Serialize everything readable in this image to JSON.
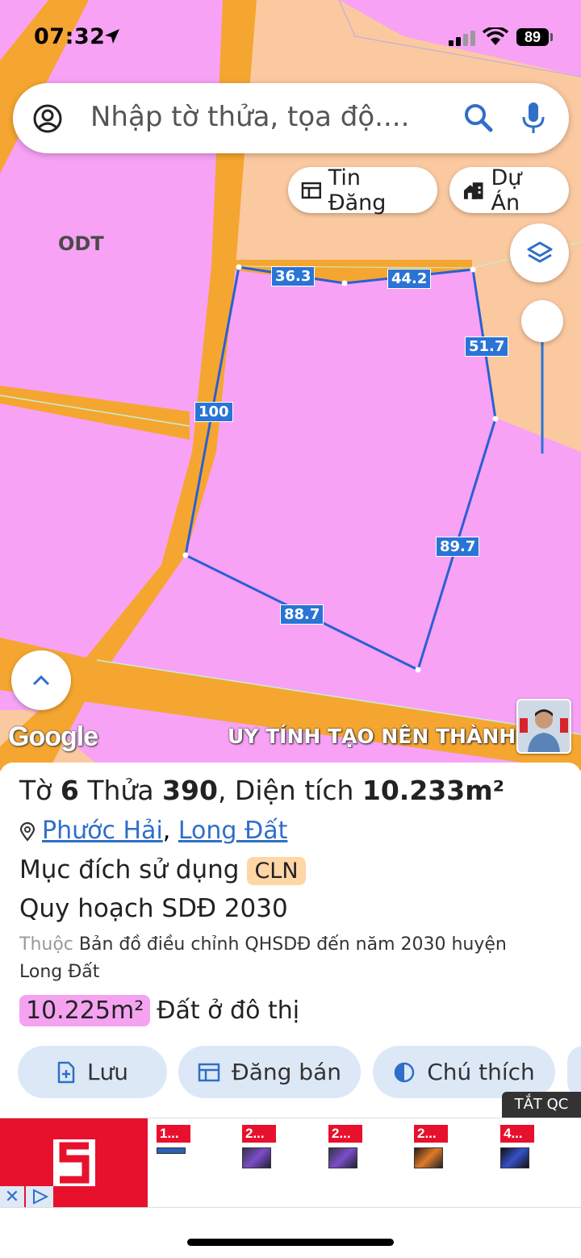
{
  "status_bar": {
    "time": "07:32",
    "battery": "89"
  },
  "search": {
    "placeholder": "Nhập tờ thửa, tọa độ...."
  },
  "chips": {
    "listings_label": "Tin Đăng",
    "projects_label": "Dự Án"
  },
  "map": {
    "zone_label": "ODT",
    "edge_lengths": [
      "36.3",
      "44.2",
      "51.7",
      "100",
      "89.7",
      "88.7"
    ],
    "google_label": "Google",
    "ticker_text": "UY TÍNH TẠO NÊN THÀNH CÔ",
    "colors": {
      "urban_land": "#f7a2f5",
      "road": "#f5a630",
      "other_land": "#fbc9a0",
      "parcel_outline": "#2a5fd6"
    }
  },
  "parcel": {
    "sheet_label": "Tờ",
    "sheet": "6",
    "plot_label": "Thửa",
    "plot": "390",
    "area_label": "Diện tích",
    "area": "10.233m²",
    "ward": "Phước Hải",
    "district": "Long Đất",
    "purpose_label": "Mục đích sử dụng",
    "purpose_code": "CLN",
    "plan_label": "Quy hoạch SDĐ 2030",
    "belongs_prefix": "Thuộc",
    "belongs_text": "Bản đồ điều chỉnh QHSDĐ đến năm 2030 huyện Long Đất",
    "planned_area": "10.225m²",
    "planned_type": "Đất ở đô thị"
  },
  "actions": {
    "save": "Lưu",
    "post_sale": "Đăng bán",
    "legend": "Chú thích"
  },
  "ad": {
    "close_label": "TẮT QC",
    "tiles": [
      "1...",
      "2...",
      "2...",
      "2...",
      "4..."
    ]
  }
}
